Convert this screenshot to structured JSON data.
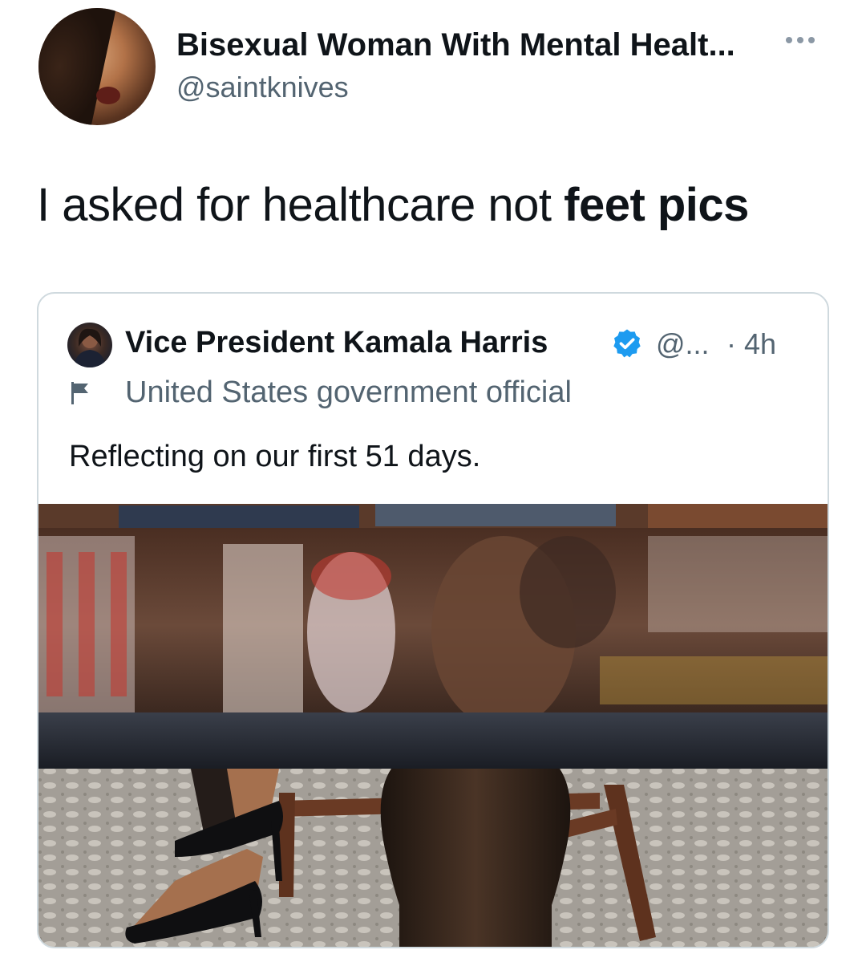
{
  "post": {
    "author_name": "Bisexual Woman With Mental Healt...",
    "author_handle": "@saintknives",
    "text_regular": "I asked for healthcare not ",
    "text_bold": "feet pics"
  },
  "quoted_post": {
    "author_name": "Vice President Kamala Harris",
    "author_handle": "@...",
    "time": "· 4h",
    "label": "United States government official",
    "text": "Reflecting on our first 51 days."
  },
  "icons": {
    "more": "more-horizontal-icon",
    "verified": "verified-badge-icon",
    "flag": "government-flag-icon"
  },
  "colors": {
    "text_primary": "#0f1419",
    "text_secondary": "#536471",
    "verified_blue": "#1d9bf0",
    "card_border": "#cfd9de"
  }
}
